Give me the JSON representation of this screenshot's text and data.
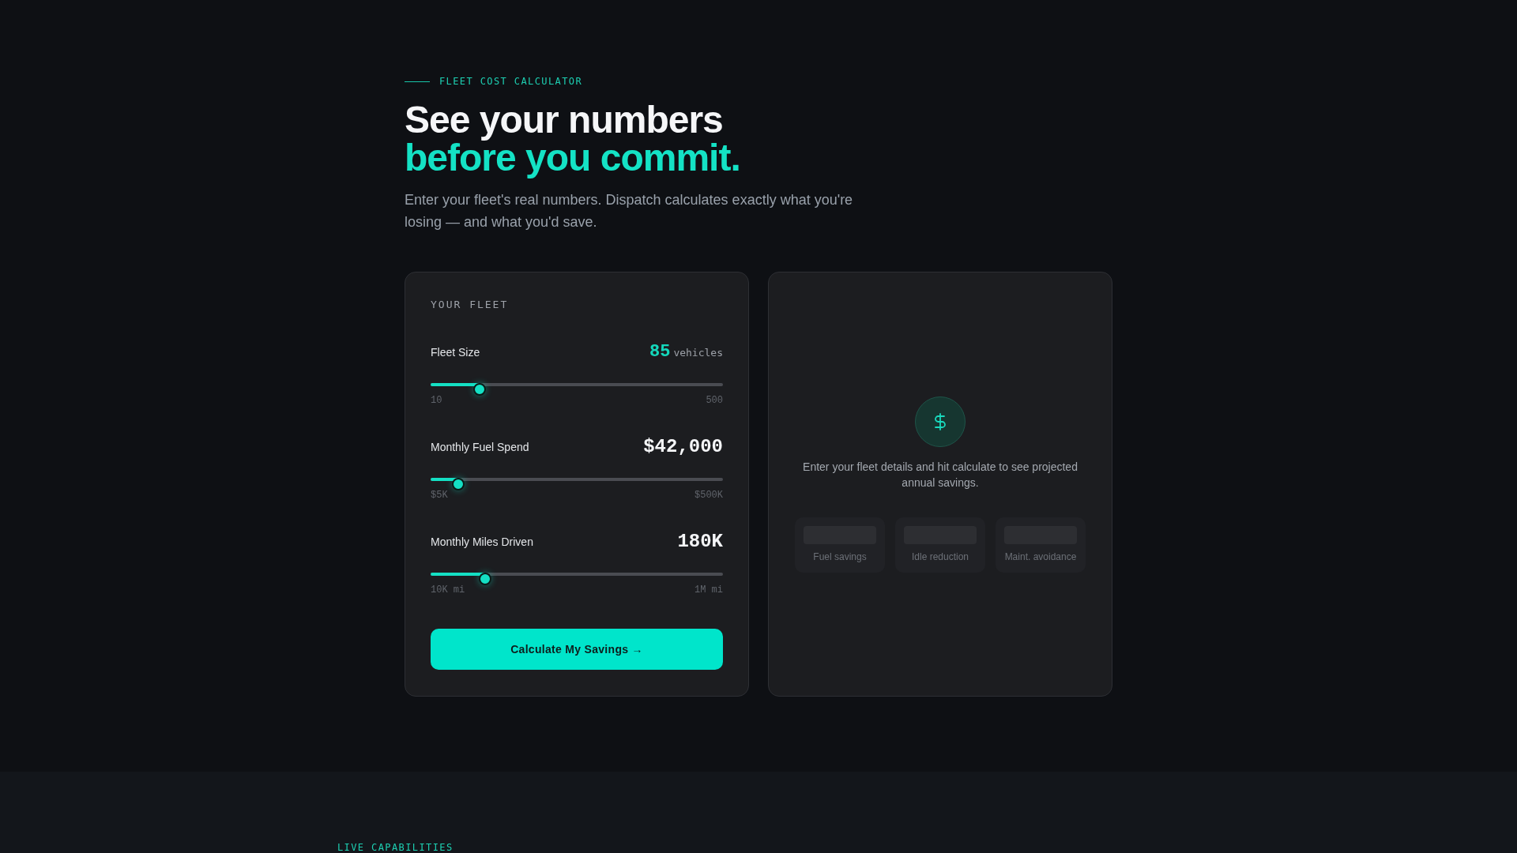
{
  "header": {
    "eyebrow": "FLEET COST CALCULATOR",
    "title": "See your numbers",
    "title_accent": "before you commit.",
    "description": "Enter your fleet's real numbers. Dispatch calculates exactly what you're losing — and what you'd save."
  },
  "fleet_panel": {
    "title": "YOUR FLEET",
    "inputs": [
      {
        "label": "Fleet Size",
        "value": "85",
        "unit": "vehicles",
        "highlighted": true,
        "level": 0.153,
        "min_label": "10",
        "max_label": "500"
      },
      {
        "label": "Monthly Fuel Spend",
        "value": "$42,000",
        "highlighted": false,
        "level": 0.075,
        "min_label": "$5K",
        "max_label": "$500K"
      },
      {
        "label": "Monthly Miles Driven",
        "value": "180K",
        "highlighted": false,
        "level": 0.172,
        "min_label": "10K mi",
        "max_label": "1M mi"
      }
    ],
    "submit_button": "Calculate My Savings →"
  },
  "results_panel": {
    "message": "Enter your fleet details and hit calculate to see projected annual savings.",
    "metrics": [
      {
        "label": "Fuel savings"
      },
      {
        "label": "Idle reduction"
      },
      {
        "label": "Maint. avoidance"
      }
    ]
  },
  "next_section": {
    "eyebrow": "LIVE CAPABILITIES"
  }
}
